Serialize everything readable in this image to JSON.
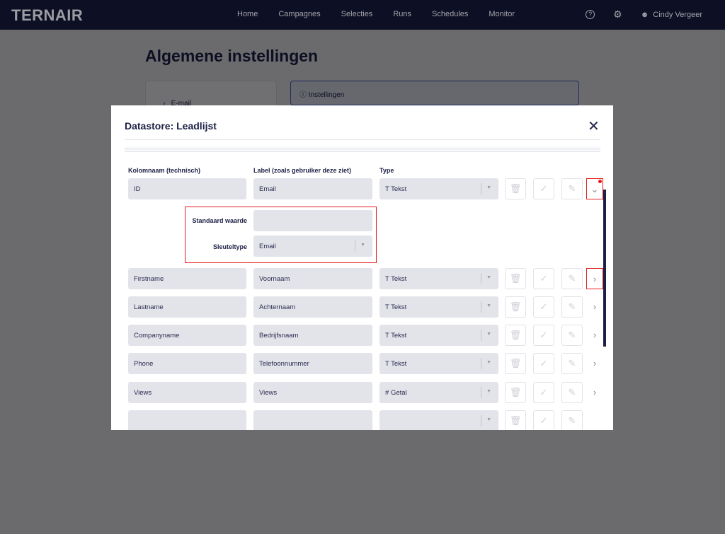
{
  "header": {
    "logo": "TERNAIR",
    "nav": [
      "Home",
      "Campagnes",
      "Selecties",
      "Runs",
      "Schedules",
      "Monitor"
    ],
    "user": "Cindy Vergeer"
  },
  "page": {
    "title": "Algemene instellingen",
    "side_item": "E-mail",
    "info": "Instellingen"
  },
  "modal": {
    "title": "Datastore: Leadlijst",
    "headers": [
      "Kolomnaam (technisch)",
      "Label (zoals gebruiker deze ziet)",
      "Type"
    ],
    "rows": [
      {
        "name": "ID",
        "label": "Email",
        "type": "Tekst",
        "type_icon": "T"
      },
      {
        "name": "Firstname",
        "label": "Voornaam",
        "type": "Tekst",
        "type_icon": "T"
      },
      {
        "name": "Lastname",
        "label": "Achternaam",
        "type": "Tekst",
        "type_icon": "T"
      },
      {
        "name": "Companyname",
        "label": "Bedrijfsnaam",
        "type": "Tekst",
        "type_icon": "T"
      },
      {
        "name": "Phone",
        "label": "Telefoonnummer",
        "type": "Tekst",
        "type_icon": "T"
      },
      {
        "name": "Views",
        "label": "Views",
        "type": "Getal",
        "type_icon": "#"
      }
    ],
    "expanded": {
      "default_label": "Standaard waarde",
      "default_value": "",
      "key_label": "Sleuteltype",
      "key_value": "Email"
    }
  }
}
